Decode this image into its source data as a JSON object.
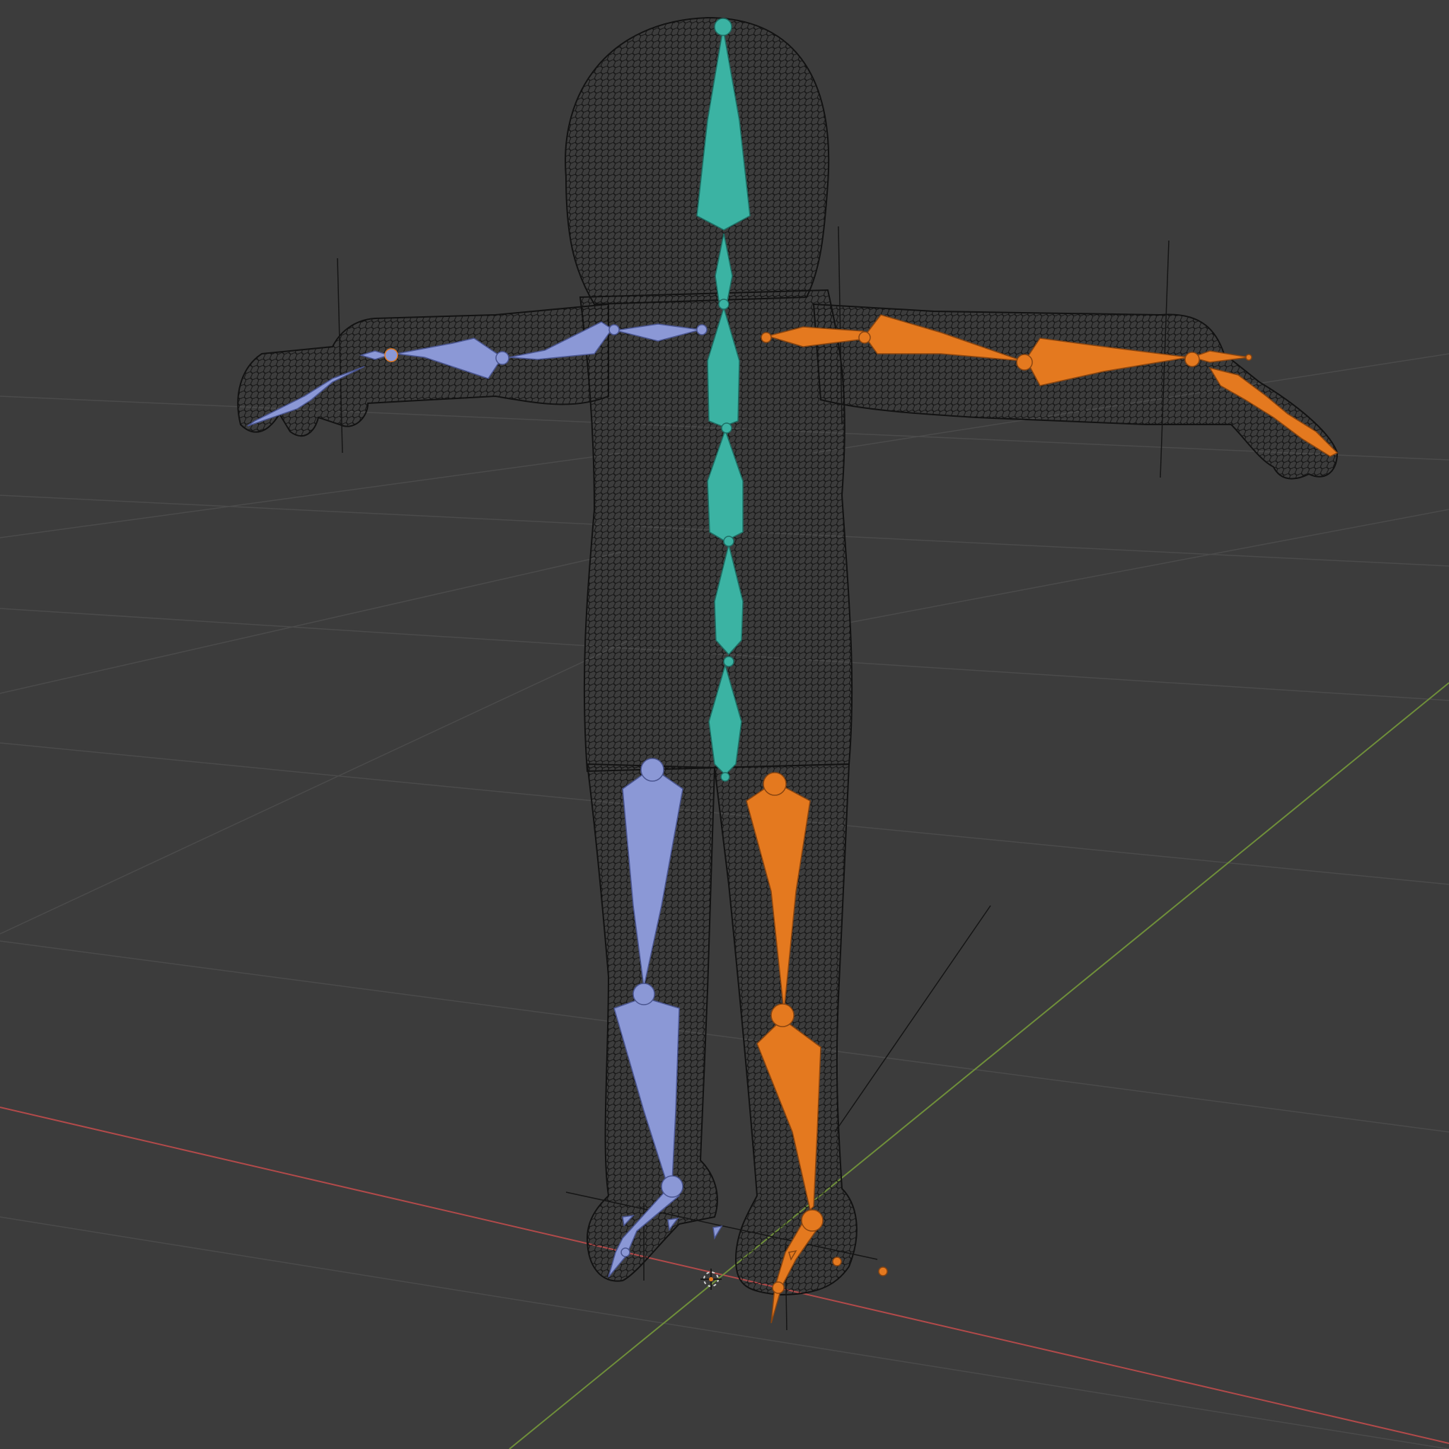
{
  "viewport": {
    "background": "#3c3c3c"
  },
  "colors": {
    "grid": "#4b4b4b",
    "x_axis": "#b24a4a",
    "y_axis": "#6f8f3a",
    "wire": "#111111",
    "bone_center": "#3bb3a3",
    "bone_left": "#8b98d6",
    "bone_right": "#e4791f"
  },
  "objects": {
    "mesh": "character-wireframe-mesh",
    "armature": "character-armature",
    "empties": 6,
    "origin": "3d-cursor"
  }
}
